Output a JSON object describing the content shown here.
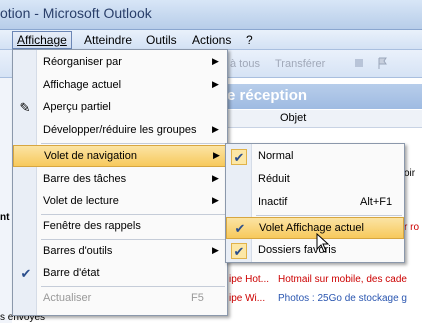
{
  "window": {
    "title": "otion - Microsoft Outlook"
  },
  "menubar": {
    "items": [
      "Affichage",
      "Atteindre",
      "Outils",
      "Actions",
      "?"
    ]
  },
  "toolbar": {
    "reply_all": "à tous",
    "forward": "Transférer"
  },
  "background": {
    "folder_header": "e réception",
    "column_object": "Objet",
    "row_fragment_1": "oir",
    "row_fragment_2": "r ro",
    "mail_rows": [
      {
        "from": "ipe Hot...",
        "subject": "Hotmail sur mobile, des cade"
      },
      {
        "from": "ipe Wi...",
        "subject": "Photos : 25Go de stockage g"
      }
    ],
    "left_fragments": [
      "nt",
      "s envoyés"
    ]
  },
  "menu": {
    "items": [
      {
        "label": "Réorganiser par",
        "submenu": true
      },
      {
        "label": "Affichage actuel",
        "submenu": true
      },
      {
        "label": "Aperçu partiel",
        "icon": "preview-icon"
      },
      {
        "label": "Développer/réduire les groupes",
        "submenu": true
      },
      {
        "label": "Volet de navigation",
        "submenu": true,
        "highlighted": true
      },
      {
        "label": "Barre des tâches",
        "submenu": true
      },
      {
        "label": "Volet de lecture",
        "submenu": true
      },
      {
        "label": "Fenêtre des rappels"
      },
      {
        "label": "Barres d'outils",
        "submenu": true
      },
      {
        "label": "Barre d'état",
        "checked": true
      },
      {
        "label": "Actualiser",
        "shortcut": "F5",
        "disabled": true
      }
    ]
  },
  "submenu": {
    "items": [
      {
        "label": "Normal",
        "checked": true
      },
      {
        "label": "Réduit"
      },
      {
        "label": "Inactif",
        "shortcut": "Alt+F1"
      },
      {
        "label": "Volet Affichage actuel",
        "checked": true,
        "highlighted": true
      },
      {
        "label": "Dossiers favoris",
        "checked": true
      }
    ]
  },
  "colors": {
    "highlight": "#f7c95c",
    "title_blue": "#2a3f6a",
    "red_text": "#cc0000"
  }
}
